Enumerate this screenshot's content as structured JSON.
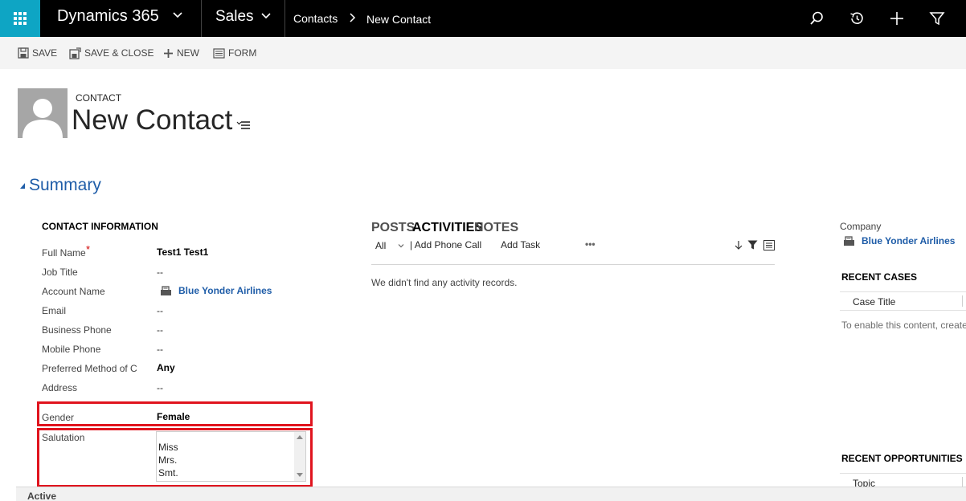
{
  "nav": {
    "app_title": "Dynamics 365",
    "area": "Sales",
    "breadcrumb": [
      "Contacts",
      "New Contact"
    ],
    "accent_color": "#0ea5c4",
    "icons": [
      "waffle-icon",
      "search-icon",
      "history-icon",
      "plus-icon",
      "filter-icon"
    ]
  },
  "commands": {
    "save": "SAVE",
    "save_close": "SAVE & CLOSE",
    "new": "NEW",
    "form": "FORM"
  },
  "header": {
    "entity": "CONTACT",
    "title": "New Contact"
  },
  "summary": {
    "title": "Summary"
  },
  "contact_info": {
    "title": "CONTACT INFORMATION",
    "fields": {
      "full_name": {
        "label": "Full Name",
        "required_mark": "*",
        "value": "Test1 Test1"
      },
      "job_title": {
        "label": "Job Title",
        "value": "--"
      },
      "account_name": {
        "label": "Account Name",
        "value": "Blue Yonder Airlines"
      },
      "email": {
        "label": "Email",
        "value": "--"
      },
      "business_phone": {
        "label": "Business Phone",
        "value": "--"
      },
      "mobile_phone": {
        "label": "Mobile Phone",
        "value": "--"
      },
      "preferred_contact": {
        "label": "Preferred Method of C",
        "value": "Any"
      },
      "address": {
        "label": "Address",
        "value": "--"
      },
      "gender": {
        "label": "Gender",
        "value": "Female"
      },
      "salutation": {
        "label": "Salutation",
        "options": [
          "Miss",
          "Mrs.",
          "Smt."
        ]
      }
    }
  },
  "activities": {
    "tabs": [
      "POSTS",
      "ACTIVITIES",
      "NOTES"
    ],
    "active_tab": "ACTIVITIES",
    "filter": "All",
    "add_phone_call": "| Add Phone Call",
    "add_task": "Add Task",
    "more": "•••",
    "empty": "We didn't find any activity records."
  },
  "right": {
    "company_label": "Company",
    "company_value": "Blue Yonder Airlines",
    "recent_cases": "RECENT CASES",
    "case_title_col": "Case Title",
    "cases_msg": "To enable this content, create",
    "recent_opps": "RECENT OPPORTUNITIES",
    "topic_col": "Topic"
  },
  "footer": {
    "status": "Active"
  },
  "highlight_color": "#e0141e"
}
